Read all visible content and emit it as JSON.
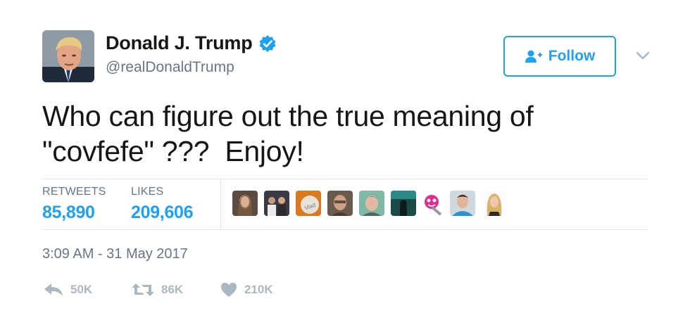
{
  "author": {
    "display_name": "Donald J. Trump",
    "handle": "@realDonaldTrump",
    "verified": true
  },
  "follow_button": {
    "label": "Follow"
  },
  "tweet": {
    "text": "Who can figure out the true meaning of\n\"covfefe\" ???  Enjoy!"
  },
  "stats": {
    "retweets_label": "RETWEETS",
    "retweets_value": "85,890",
    "likes_label": "LIKES",
    "likes_value": "209,606"
  },
  "likers": [
    {
      "name": "liker-1"
    },
    {
      "name": "liker-2"
    },
    {
      "name": "liker-3",
      "badge_text": "Vlad"
    },
    {
      "name": "liker-4"
    },
    {
      "name": "liker-5"
    },
    {
      "name": "liker-6"
    },
    {
      "name": "liker-7"
    },
    {
      "name": "liker-8"
    },
    {
      "name": "liker-9"
    }
  ],
  "timestamp": "3:09 AM - 31 May 2017",
  "actions": {
    "reply_count": "50K",
    "retweet_count": "86K",
    "like_count": "210K"
  },
  "colors": {
    "accent": "#1da1f2",
    "text": "#14171a",
    "muted": "#657786",
    "action_gray": "#aab8c2"
  },
  "icons": {
    "verified": "verified-badge-icon",
    "follow": "add-user-icon",
    "caret": "chevron-down-icon",
    "reply": "reply-icon",
    "retweet": "retweet-icon",
    "like": "heart-icon"
  }
}
